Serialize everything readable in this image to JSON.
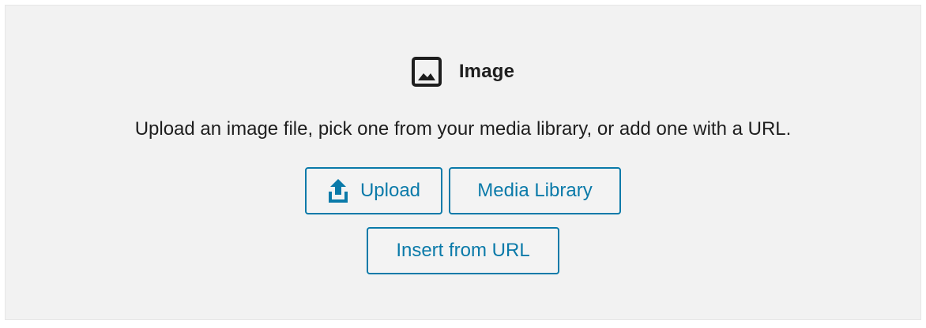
{
  "block": {
    "icon": "image-icon",
    "title": "Image",
    "instructions": "Upload an image file, pick one from your media library, or add one with a URL."
  },
  "buttons": {
    "upload": {
      "label": "Upload",
      "icon": "upload-icon"
    },
    "media_library": {
      "label": "Media Library"
    },
    "insert_url": {
      "label": "Insert from URL"
    }
  },
  "colors": {
    "accent": "#0a7aa9",
    "background": "#f2f2f2",
    "text": "#1e1e1e"
  }
}
